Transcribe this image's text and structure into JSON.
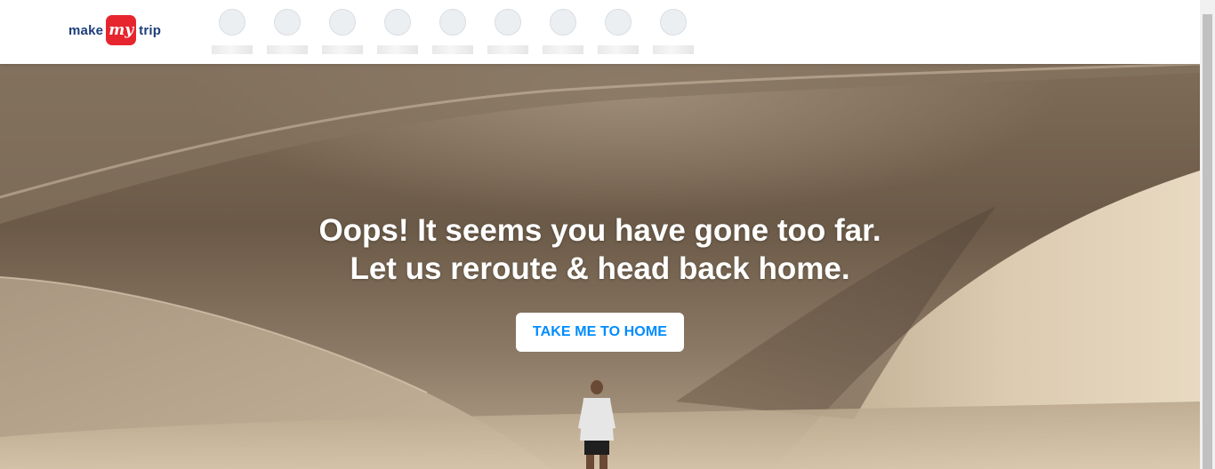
{
  "header": {
    "logo": {
      "part1": "make",
      "part2": "my",
      "part3": "trip",
      "brand_color": "#e7252f",
      "text_color": "#1d3e7a"
    },
    "nav_placeholders": [
      "nav-1",
      "nav-2",
      "nav-3",
      "nav-4",
      "nav-5",
      "nav-6",
      "nav-7",
      "nav-8",
      "nav-9"
    ]
  },
  "hero": {
    "message_line1": "Oops! It seems you have gone too far.",
    "message_line2": "Let us reroute & head back home.",
    "button_label": "TAKE ME TO HOME",
    "button_text_color": "#008cff",
    "background_description": "desert-dunes-with-hiker"
  }
}
